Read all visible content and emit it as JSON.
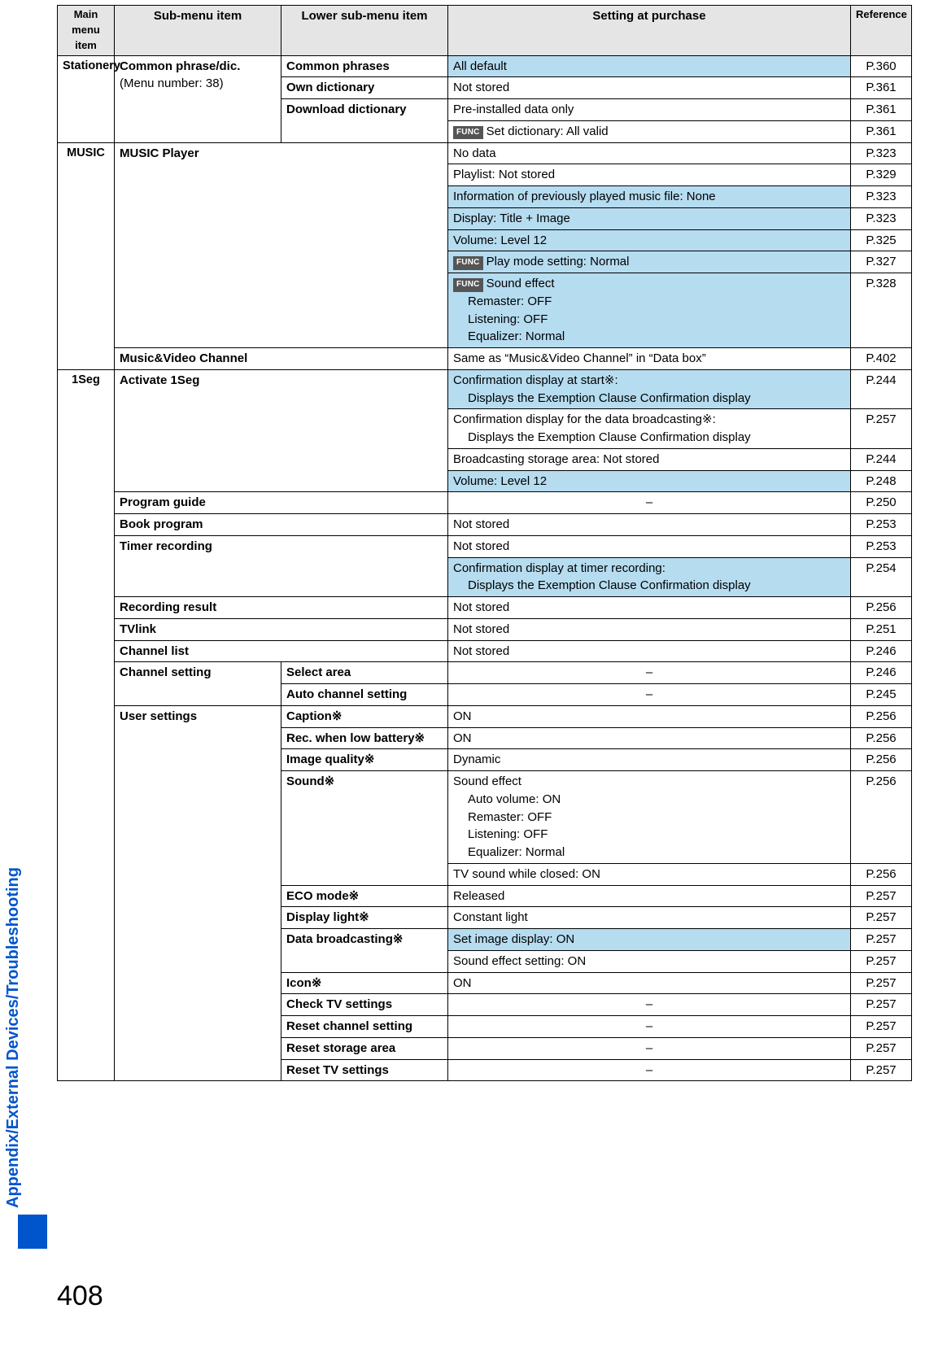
{
  "page_number": "408",
  "side_label": "Appendix/External Devices/Troubleshooting",
  "headers": {
    "main": "Main menu item",
    "sub": "Sub-menu item",
    "lower": "Lower sub-menu item",
    "setting": "Setting at purchase",
    "ref": "Reference"
  },
  "func_label": "FUNC",
  "stationery": {
    "main": "Stationery",
    "sub": "Common phrase/dic.",
    "sub_note": "(Menu number: 38)",
    "rows": [
      {
        "lower": "Common phrases",
        "setting": "All default",
        "ref": "P.360",
        "hl": true
      },
      {
        "lower": "Own dictionary",
        "setting": "Not stored",
        "ref": "P.361"
      },
      {
        "lower": "Download dictionary",
        "setting": "Pre-installed data only",
        "ref": "P.361"
      },
      {
        "lower_cont": true,
        "func": true,
        "setting": "Set dictionary: All valid",
        "ref": "P.361"
      }
    ]
  },
  "music": {
    "main": "MUSIC",
    "player": {
      "label": "MUSIC Player",
      "rows": [
        {
          "setting": "No data",
          "ref": "P.323"
        },
        {
          "setting": "Playlist: Not stored",
          "ref": "P.329"
        },
        {
          "setting": "Information of previously played music file: None",
          "ref": "P.323",
          "hl": true
        },
        {
          "setting": "Display: Title + Image",
          "ref": "P.323",
          "hl": true
        },
        {
          "setting": "Volume: Level 12",
          "ref": "P.325",
          "hl": true
        },
        {
          "func": true,
          "setting": "Play mode setting: Normal",
          "ref": "P.327",
          "hl": true
        },
        {
          "func": true,
          "setting_lines": [
            "Sound effect",
            "Remaster: OFF",
            "Listening: OFF",
            "Equalizer: Normal"
          ],
          "ref": "P.328",
          "hl": true
        }
      ]
    },
    "mv": {
      "label": "Music&Video Channel",
      "setting": "Same as “Music&Video Channel” in “Data box”",
      "ref": "P.402"
    }
  },
  "oneseg": {
    "main": "1Seg",
    "activate": {
      "label": "Activate 1Seg",
      "rows": [
        {
          "setting_lines": [
            "Confirmation display at start※:",
            "Displays the Exemption Clause Confirmation display"
          ],
          "ref": "P.244",
          "hl": true
        },
        {
          "setting_lines": [
            "Confirmation display for the data broadcasting※:",
            "Displays the Exemption Clause Confirmation display"
          ],
          "ref": "P.257"
        },
        {
          "setting": "Broadcasting storage area: Not stored",
          "ref": "P.244"
        },
        {
          "setting": "Volume: Level 12",
          "ref": "P.248",
          "hl": true
        }
      ]
    },
    "simple": {
      "program_guide": {
        "label": "Program guide",
        "setting": "–",
        "ref": "P.250"
      },
      "book_program": {
        "label": "Book program",
        "setting": "Not stored",
        "ref": "P.253"
      },
      "timer": {
        "label": "Timer recording",
        "rows": [
          {
            "setting": "Not stored",
            "ref": "P.253"
          },
          {
            "setting_lines": [
              "Confirmation display at timer recording:",
              "Displays the Exemption Clause Confirmation display"
            ],
            "ref": "P.254",
            "hl": true
          }
        ]
      },
      "recording_result": {
        "label": "Recording result",
        "setting": "Not stored",
        "ref": "P.256"
      },
      "tvlink": {
        "label": "TVlink",
        "setting": "Not stored",
        "ref": "P.251"
      },
      "channel_list": {
        "label": "Channel list",
        "setting": "Not stored",
        "ref": "P.246"
      }
    },
    "channel_setting": {
      "label": "Channel setting",
      "rows": [
        {
          "lower": "Select area",
          "setting": "–",
          "ref": "P.246"
        },
        {
          "lower": "Auto channel setting",
          "setting": "–",
          "ref": "P.245"
        }
      ]
    },
    "user_settings": {
      "label": "User settings",
      "rows": [
        {
          "lower": "Caption※",
          "setting": "ON",
          "ref": "P.256"
        },
        {
          "lower": "Rec. when low battery※",
          "setting": "ON",
          "ref": "P.256"
        },
        {
          "lower": "Image quality※",
          "setting": "Dynamic",
          "ref": "P.256"
        },
        {
          "lower": "Sound※",
          "setting_lines": [
            "Sound effect",
            "Auto volume: ON",
            "Remaster: OFF",
            "Listening: OFF",
            "Equalizer: Normal"
          ],
          "ref": "P.256"
        },
        {
          "lower_cont": true,
          "setting": "TV sound while closed: ON",
          "ref": "P.256"
        },
        {
          "lower": "ECO mode※",
          "setting": "Released",
          "ref": "P.257"
        },
        {
          "lower": "Display light※",
          "setting": "Constant light",
          "ref": "P.257"
        },
        {
          "lower": "Data broadcasting※",
          "setting": "Set image display: ON",
          "ref": "P.257",
          "hl": true
        },
        {
          "lower_cont": true,
          "setting": "Sound effect setting: ON",
          "ref": "P.257"
        },
        {
          "lower": "Icon※",
          "setting": "ON",
          "ref": "P.257"
        },
        {
          "lower": "Check TV settings",
          "setting": "–",
          "ref": "P.257"
        },
        {
          "lower": "Reset channel setting",
          "setting": "–",
          "ref": "P.257"
        },
        {
          "lower": "Reset storage area",
          "setting": "–",
          "ref": "P.257"
        },
        {
          "lower": "Reset TV settings",
          "setting": "–",
          "ref": "P.257"
        }
      ]
    }
  }
}
